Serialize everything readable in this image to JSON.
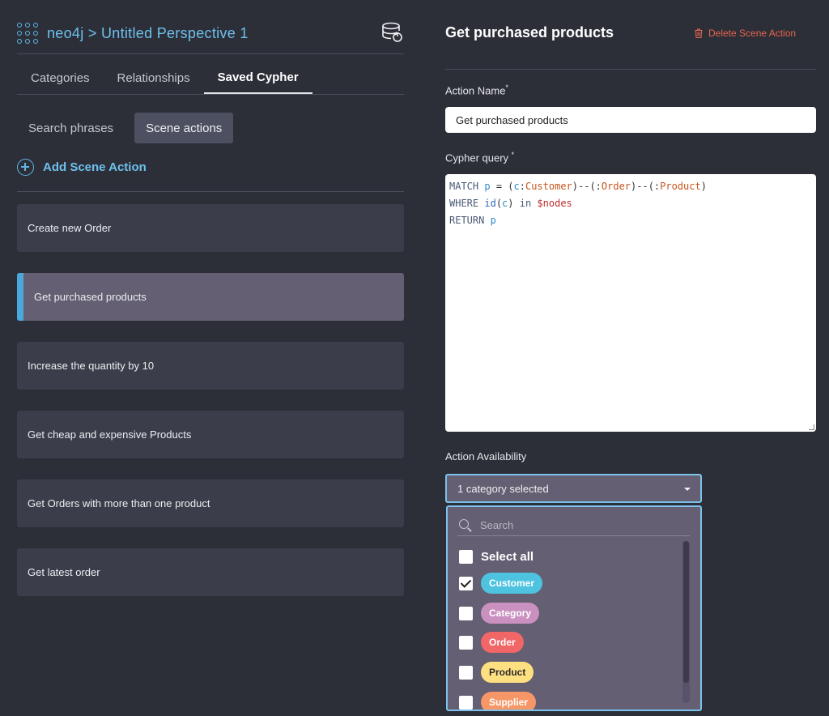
{
  "header": {
    "title": "neo4j > Untitled Perspective 1"
  },
  "tabs": [
    {
      "label": "Categories"
    },
    {
      "label": "Relationships"
    },
    {
      "label": "Saved Cypher"
    }
  ],
  "subtabs": [
    {
      "label": "Search phrases"
    },
    {
      "label": "Scene actions"
    }
  ],
  "add_action_label": "Add Scene Action",
  "scene_actions": [
    {
      "label": "Create new Order"
    },
    {
      "label": "Get purchased products"
    },
    {
      "label": "Increase the quantity by 10"
    },
    {
      "label": "Get cheap and expensive Products"
    },
    {
      "label": "Get Orders with more than one product"
    },
    {
      "label": "Get latest order"
    }
  ],
  "detail": {
    "title": "Get purchased products",
    "delete_label": "Delete Scene Action",
    "action_name_label": "Action Name",
    "action_name_value": "Get purchased products",
    "cypher_label": "Cypher query",
    "required_mark": "*",
    "cypher_lines": [
      "MATCH p = (c:Customer)--(:Order)--(:Product)",
      "WHERE id(c) in $nodes",
      "RETURN p"
    ],
    "availability_label": "Action Availability",
    "availability_value": "1 category selected",
    "search_placeholder": "Search",
    "select_all_label": "Select all",
    "categories": [
      {
        "label": "Customer",
        "checked": true,
        "color": "#4ec3e0",
        "text_color": "#ffffff"
      },
      {
        "label": "Category",
        "checked": false,
        "color": "#c990c0",
        "text_color": "#ffffff"
      },
      {
        "label": "Order",
        "checked": false,
        "color": "#f16667",
        "text_color": "#ffffff"
      },
      {
        "label": "Product",
        "checked": false,
        "color": "#ffe081",
        "text_color": "#2a2a2a"
      },
      {
        "label": "Supplier",
        "checked": false,
        "color": "#f79767",
        "text_color": "#ffffff"
      }
    ]
  },
  "colors": {
    "accent": "#5fb6e8",
    "danger": "#e8644e",
    "selected_row": "#645f72"
  }
}
